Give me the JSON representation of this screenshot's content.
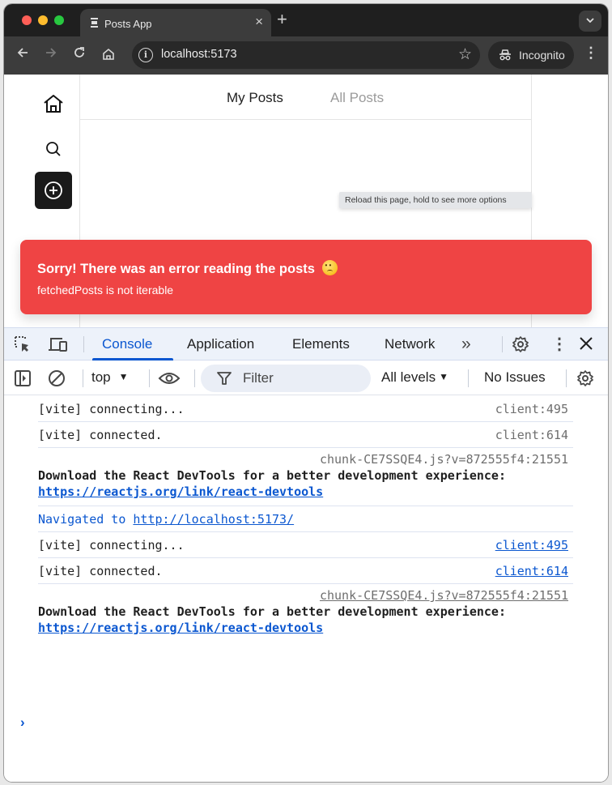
{
  "browser": {
    "tab_title": "Posts App",
    "new_tab_label": "+",
    "url": "localhost:5173",
    "incognito_label": "Incognito"
  },
  "page": {
    "sidebar": {
      "items": [
        {
          "name": "home",
          "icon": "home-icon"
        },
        {
          "name": "search",
          "icon": "search-icon"
        },
        {
          "name": "create-post",
          "icon": "plus-circle-icon"
        }
      ]
    },
    "tabs": [
      {
        "label": "My Posts",
        "active": true
      },
      {
        "label": "All Posts",
        "active": false
      }
    ],
    "tooltip": "Reload this page, hold to see more options",
    "error": {
      "title": "Sorry! There was an error reading the posts",
      "emoji": "slightly-frowning-face",
      "message": "fetchedPosts is not iterable",
      "color": "#ef4444"
    }
  },
  "devtools": {
    "tabs": [
      {
        "label": "Console",
        "active": true
      },
      {
        "label": "Application",
        "active": false
      },
      {
        "label": "Elements",
        "active": false
      },
      {
        "label": "Network",
        "active": false
      }
    ],
    "more_tabs": "»",
    "context": "top",
    "filter_placeholder": "Filter",
    "levels": "All levels",
    "issues": "No Issues",
    "accent": "#0b57d0",
    "console": [
      {
        "type": "log",
        "text": "[vite] connecting...",
        "source": "client:495",
        "source_link": false
      },
      {
        "type": "log",
        "text": "[vite] connected.",
        "source": "client:614",
        "source_link": false
      },
      {
        "type": "multi",
        "source": "chunk-CE7SSQE4.js?v=872555f4:21551",
        "source_link": false,
        "text": "Download the React DevTools for a better development experience:",
        "link": "https://reactjs.org/link/react-devtools"
      },
      {
        "type": "nav",
        "prefix": "Navigated to ",
        "link": "http://localhost:5173/"
      },
      {
        "type": "log",
        "text": "[vite] connecting...",
        "source": "client:495",
        "source_link": true
      },
      {
        "type": "log",
        "text": "[vite] connected.",
        "source": "client:614",
        "source_link": true
      },
      {
        "type": "multi",
        "source": "chunk-CE7SSQE4.js?v=872555f4:21551",
        "source_link": true,
        "text": "Download the React DevTools for a better development experience:",
        "link": "https://reactjs.org/link/react-devtools"
      }
    ],
    "prompt": "›"
  }
}
